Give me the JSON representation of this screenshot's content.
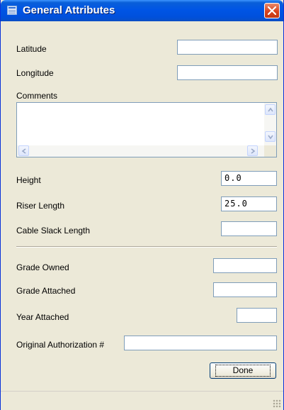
{
  "window": {
    "title": "General Attributes"
  },
  "fields": {
    "latitude": {
      "label": "Latitude",
      "value": ""
    },
    "longitude": {
      "label": "Longitude",
      "value": ""
    },
    "comments": {
      "label": "Comments",
      "value": ""
    },
    "height": {
      "label": "Height",
      "value": "0.0"
    },
    "riser_length": {
      "label": "Riser Length",
      "value": "25.0"
    },
    "cable_slack": {
      "label": "Cable Slack Length",
      "value": ""
    },
    "grade_owned": {
      "label": "Grade Owned",
      "value": ""
    },
    "grade_attached": {
      "label": "Grade Attached",
      "value": ""
    },
    "year_attached": {
      "label": "Year Attached",
      "value": ""
    },
    "orig_auth": {
      "label": "Original Authorization #",
      "value": ""
    }
  },
  "buttons": {
    "done": "Done"
  },
  "icons": {
    "title": "table-icon",
    "close": "close-icon",
    "scroll_up": "chevron-up-icon",
    "scroll_down": "chevron-down-icon",
    "scroll_left": "chevron-left-icon",
    "scroll_right": "chevron-right-icon",
    "grip": "resize-grip-icon"
  },
  "colors": {
    "titlebar": "#0055e5",
    "close": "#d8431d",
    "background": "#ece9d8"
  }
}
